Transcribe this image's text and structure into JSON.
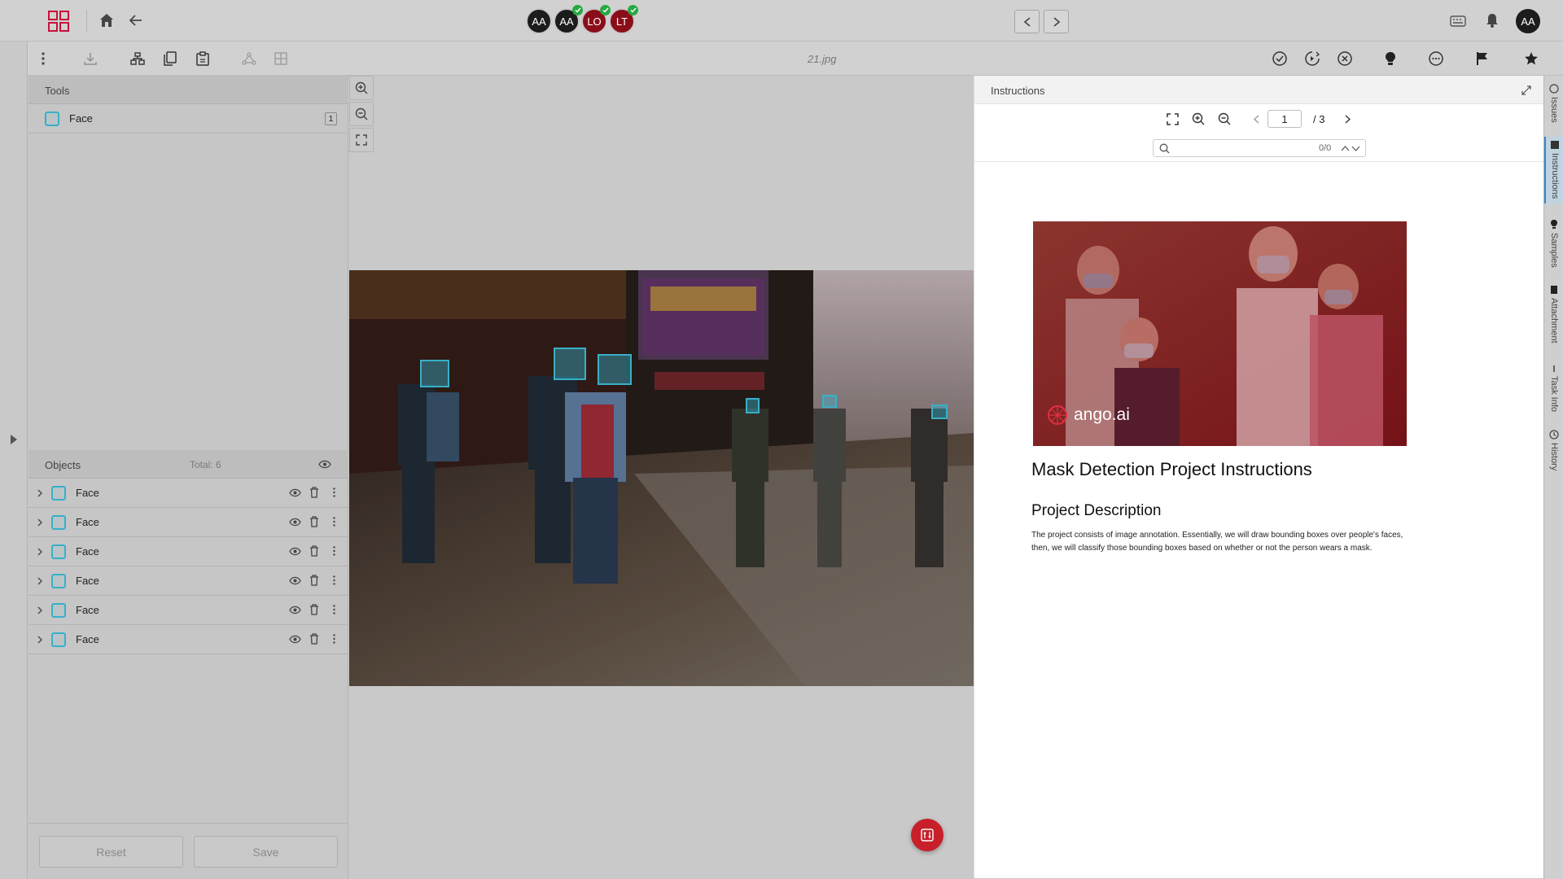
{
  "topbar": {
    "avatars": [
      {
        "initials": "AA",
        "color": "#1c1c1c",
        "check": false
      },
      {
        "initials": "AA",
        "color": "#1c1c1c",
        "check": true
      },
      {
        "initials": "LO",
        "color": "#8a0e1a",
        "check": true
      },
      {
        "initials": "LT",
        "color": "#8a0e1a",
        "check": true
      }
    ],
    "user_initials": "AA",
    "accent": "#c8103a"
  },
  "toolbar": {
    "filename": "21.jpg"
  },
  "tools": {
    "title": "Tools",
    "items": [
      {
        "label": "Face",
        "hotkey": "1",
        "color": "#37b0c8"
      }
    ]
  },
  "objects": {
    "title": "Objects",
    "total": "Total: 6",
    "rows": [
      "Face",
      "Face",
      "Face",
      "Face",
      "Face",
      "Face"
    ]
  },
  "buttons": {
    "reset": "Reset",
    "save": "Save"
  },
  "instructions": {
    "title": "Instructions",
    "page_current": "1",
    "page_total": "/ 3",
    "search_count": "0/0",
    "logo_text": "ango.ai",
    "doc_title": "Mask Detection Project Instructions",
    "section_title": "Project Description",
    "paragraph": "The project consists of image annotation. Essentially, we will draw bounding boxes over people's faces, then, we will classify those bounding boxes based on whether or not the person wears a mask."
  },
  "right_tabs": [
    "Issues",
    "Instructions",
    "Samples",
    "Attachment",
    "Task Info",
    "History"
  ],
  "annotation_color": "#37b0c8",
  "fab_color": "#c8202a"
}
